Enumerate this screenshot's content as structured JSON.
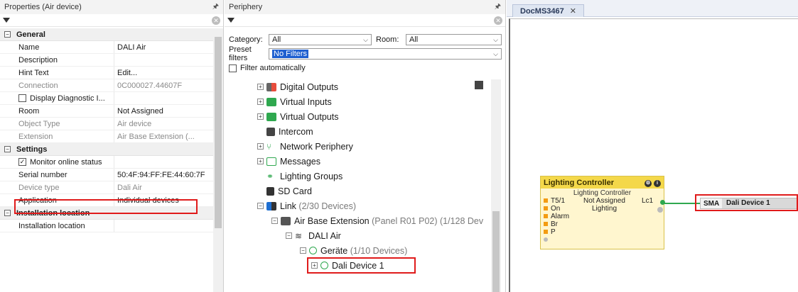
{
  "properties": {
    "title": "Properties (Air device)",
    "categories": {
      "general": "General",
      "settings": "Settings",
      "installation": "Installation location"
    },
    "rows": [
      {
        "name": "Name",
        "value": "DALI Air"
      },
      {
        "name": "Description",
        "value": ""
      },
      {
        "name": "Hint Text",
        "value": "Edit..."
      },
      {
        "name": "Connection",
        "value": "0C000027.44607F"
      },
      {
        "name": "Display Diagnostic I...",
        "value": ""
      },
      {
        "name": "Room",
        "value": "Not Assigned"
      },
      {
        "name": "Object Type",
        "value": "Air device"
      },
      {
        "name": "Extension",
        "value": "Air Base Extension (..."
      },
      {
        "name": "Monitor online status",
        "value": ""
      },
      {
        "name": "Serial number",
        "value": "50:4F:94:FF:FE:44:60:7F"
      },
      {
        "name": "Device type",
        "value": "Dali Air"
      },
      {
        "name": "Application",
        "value": "Individual devices"
      },
      {
        "name": "Installation location",
        "value": ""
      }
    ]
  },
  "periphery": {
    "title": "Periphery",
    "category_label": "Category:",
    "category_value": "All",
    "room_label": "Room:",
    "room_value": "All",
    "preset_label": "Preset filters",
    "preset_value": "No Filters",
    "filter_auto": "Filter automatically",
    "tree": {
      "digital_outputs": "Digital Outputs",
      "virtual_inputs": "Virtual Inputs",
      "virtual_outputs": "Virtual Outputs",
      "intercom": "Intercom",
      "network_periphery": "Network Periphery",
      "messages": "Messages",
      "lighting_groups": "Lighting Groups",
      "sd_card": "SD Card",
      "link": "Link",
      "link_count": "(2/30 Devices)",
      "air_base": "Air Base Extension",
      "air_base_detail": "(Panel R01 P02) (1/128 Dev",
      "dali_air": "DALI Air",
      "geraete": "Geräte",
      "geraete_count": "(1/10 Devices)",
      "dali_device": "Dali Device 1"
    }
  },
  "document": {
    "tab_label": "DocMS3467",
    "lc": {
      "title": "Lighting Controller",
      "subtitle": "Lighting Controller",
      "room": "Not Assigned",
      "category": "Lighting",
      "inputs": [
        "T5/1",
        "On",
        "Alarm",
        "Br",
        "P"
      ],
      "output": "Lc1"
    },
    "sma": {
      "label": "SMA",
      "name": "Dali Device 1"
    }
  }
}
